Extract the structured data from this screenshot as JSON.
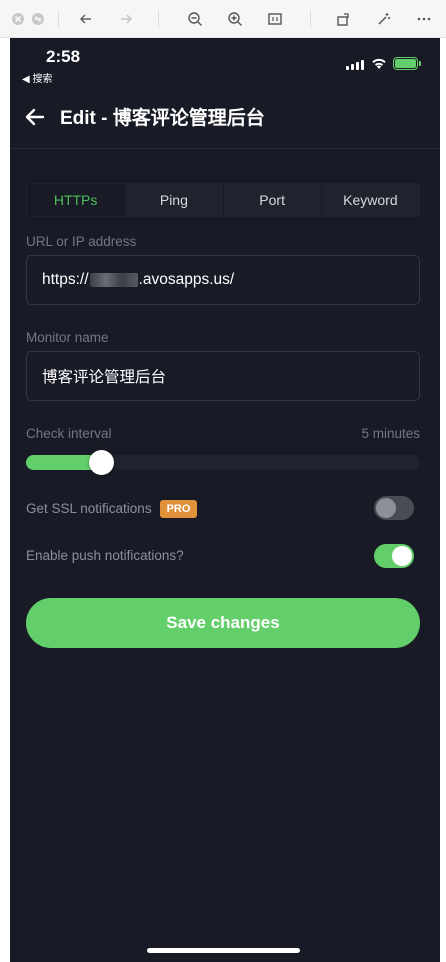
{
  "status_bar": {
    "time": "2:58",
    "back_app": "◀ 搜索"
  },
  "header": {
    "title": "Edit - 博客评论管理后台"
  },
  "tabs": [
    {
      "label": "HTTPs",
      "active": true
    },
    {
      "label": "Ping",
      "active": false
    },
    {
      "label": "Port",
      "active": false
    },
    {
      "label": "Keyword",
      "active": false
    }
  ],
  "url_field": {
    "label": "URL or IP address",
    "value_prefix": "https://",
    "value_suffix": ".avosapps.us/"
  },
  "name_field": {
    "label": "Monitor name",
    "value": "博客评论管理后台"
  },
  "check_interval": {
    "label": "Check interval",
    "value_text": "5 minutes",
    "slider_fraction": 0.19
  },
  "ssl": {
    "label": "Get SSL notifications",
    "badge": "PRO",
    "enabled": false
  },
  "push": {
    "label": "Enable push notifications?",
    "enabled": true
  },
  "save_button": {
    "label": "Save changes"
  },
  "colors": {
    "accent": "#63cf6a",
    "background": "#181b25",
    "badge": "#e0913a"
  },
  "viewer_toolbar": {
    "icons": [
      "close-window-icon",
      "minimize-window-icon",
      "back-icon",
      "forward-icon",
      "zoom-out-icon",
      "zoom-in-icon",
      "fit-page-icon",
      "rotate-icon",
      "markup-icon",
      "more-icon"
    ]
  }
}
